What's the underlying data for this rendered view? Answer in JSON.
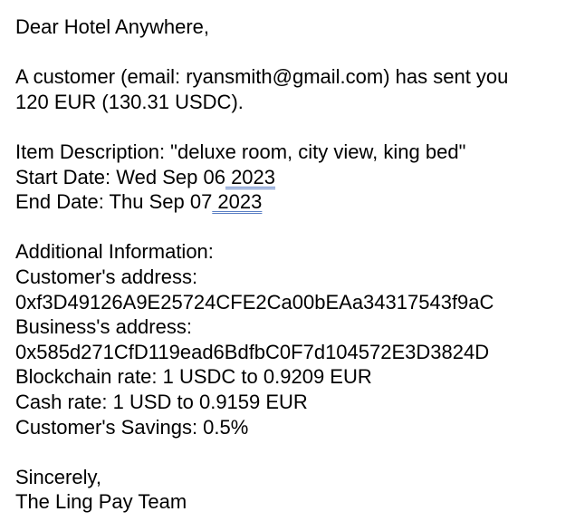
{
  "email": {
    "greeting": "Dear Hotel Anywhere,",
    "intro_line1": "A customer (email: ryansmith@gmail.com) has sent you",
    "intro_line2": "120 EUR (130.31 USDC).",
    "item_description": "Item Description: \"deluxe room, city view, king bed\"",
    "start_date_prefix": "Start Date: Wed Sep 06",
    "start_date_year": " 2023",
    "end_date_prefix": "End Date: Thu Sep 07",
    "end_date_year": " 2023",
    "additional_info_label": "Additional Information:",
    "customer_address_label": "Customer's address:",
    "customer_address": "0xf3D49126A9E25724CFE2Ca00bEAa34317543f9aC",
    "business_address_label": "Business's address:",
    "business_address": "0x585d271CfD119ead6BdfbC0F7d104572E3D3824D",
    "blockchain_rate": "Blockchain rate: 1 USDC to 0.9209 EUR",
    "cash_rate": "Cash rate: 1 USD to 0.9159 EUR",
    "customer_savings": "Customer's Savings: 0.5%",
    "closing": "Sincerely,",
    "signature": "The Ling Pay Team"
  },
  "colors": {
    "text": "#000000",
    "date_underline": "#5b7fc4",
    "background": "#ffffff"
  }
}
